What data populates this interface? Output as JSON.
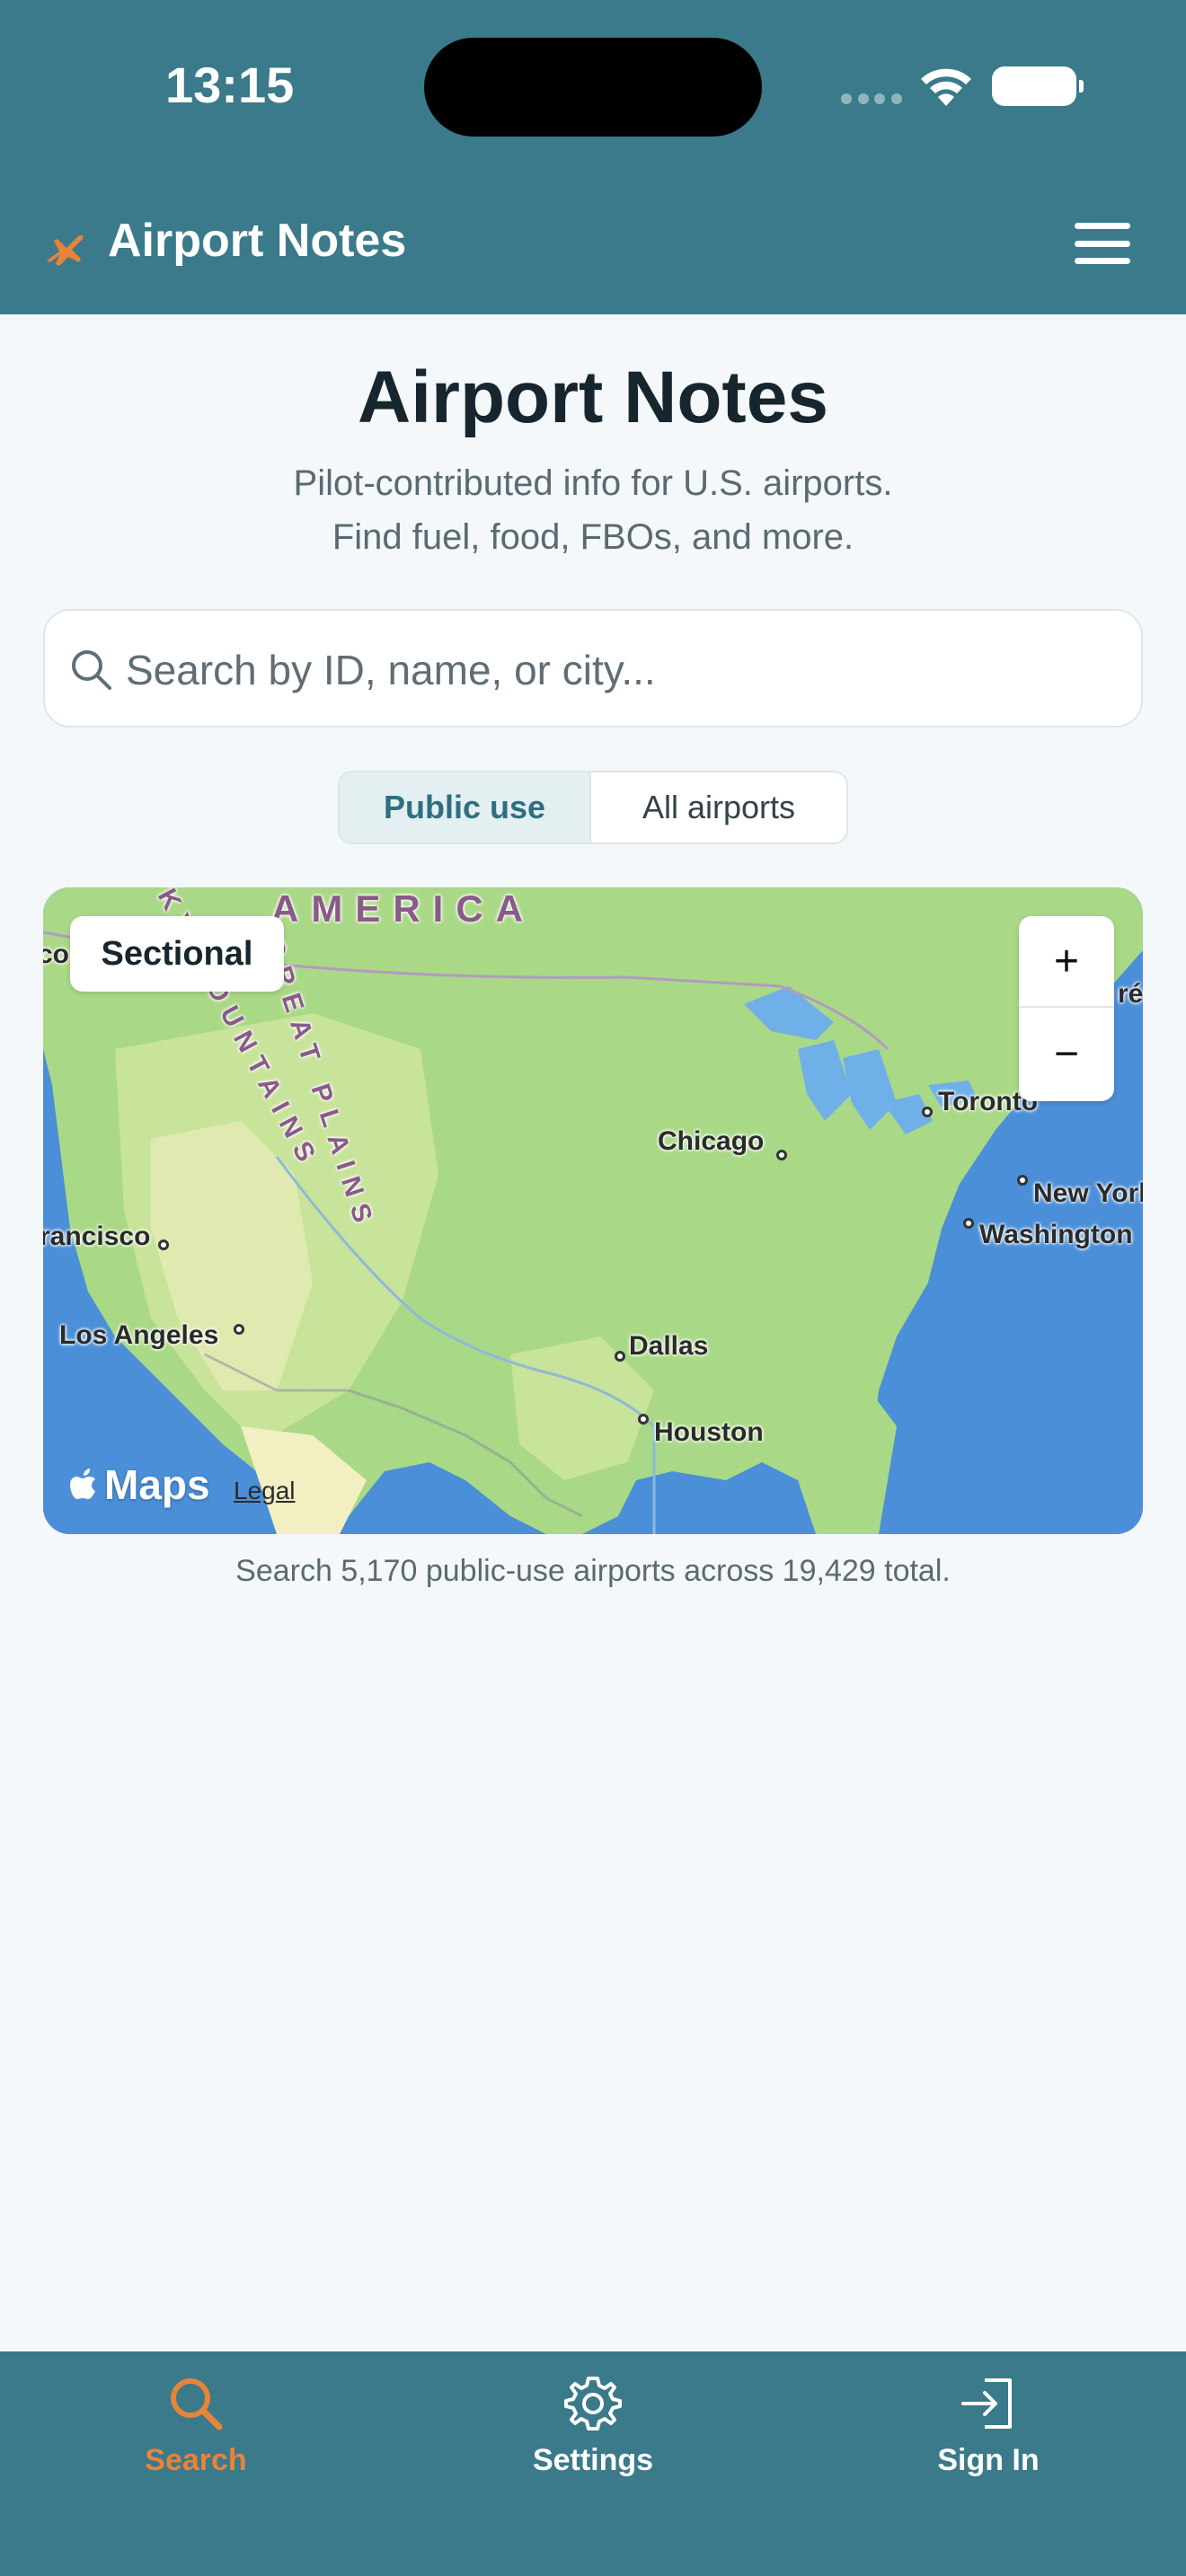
{
  "status_bar": {
    "time": "13:15"
  },
  "header": {
    "title": "Airport Notes",
    "menu_icon": "hamburger-menu-icon",
    "logo_icon": "airplane-icon"
  },
  "main": {
    "title": "Airport Notes",
    "subtitle_line1": "Pilot-contributed info for U.S. airports.",
    "subtitle_line2": "Find fuel, food, FBOs, and more.",
    "search": {
      "placeholder": "Search by ID, name, or city...",
      "value": ""
    },
    "filter": {
      "options": [
        "Public use",
        "All airports"
      ],
      "selected": "Public use"
    },
    "map": {
      "layer_button": "Sectional",
      "zoom_in": "+",
      "zoom_out": "−",
      "region_label": "AMERICA",
      "rocky_label": "KY MOUNTAINS",
      "plains_label": "GREAT PLAINS",
      "cities": [
        "Chicago",
        "Toronto",
        "New York",
        "Washington",
        "rancisco",
        "Los Angeles",
        "Dallas",
        "Houston"
      ],
      "edge_left": "co",
      "edge_right": "ré",
      "attribution": "Maps",
      "legal": "Legal"
    },
    "caption": "Search 5,170 public-use airports across 19,429 total."
  },
  "tabs": [
    {
      "label": "Search",
      "icon": "search-icon",
      "active": true
    },
    {
      "label": "Settings",
      "icon": "gear-icon",
      "active": false
    },
    {
      "label": "Sign In",
      "icon": "sign-in-icon",
      "active": false
    }
  ],
  "colors": {
    "brand": "#3a7a8a",
    "accent": "#e8833a",
    "background": "#f4f8fa"
  }
}
